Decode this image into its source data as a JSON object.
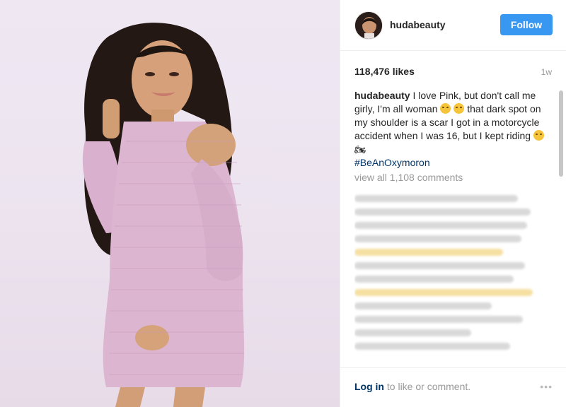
{
  "post": {
    "username": "hudabeauty",
    "follow_label": "Follow",
    "likes": "118,476 likes",
    "age": "1w",
    "caption": {
      "user": "hudabeauty",
      "text_1": " I love Pink, but don't call me girly, I'm all woman ",
      "text_2": " that dark spot on my shoulder is a scar I got in a motorcycle accident when I was 16, but I kept riding ",
      "hashtag": "#BeAnOxymoron"
    },
    "view_all_comments": "view all 1,108 comments",
    "login_link": "Log in",
    "login_suffix": " to like or comment.",
    "more_icon": "•••"
  },
  "icons": {
    "follow": "follow-button",
    "more": "more-options-icon"
  },
  "colors": {
    "follow_button": "#3897f0",
    "link": "#003569",
    "muted": "#999999",
    "photo_background": "#ece3ef"
  }
}
